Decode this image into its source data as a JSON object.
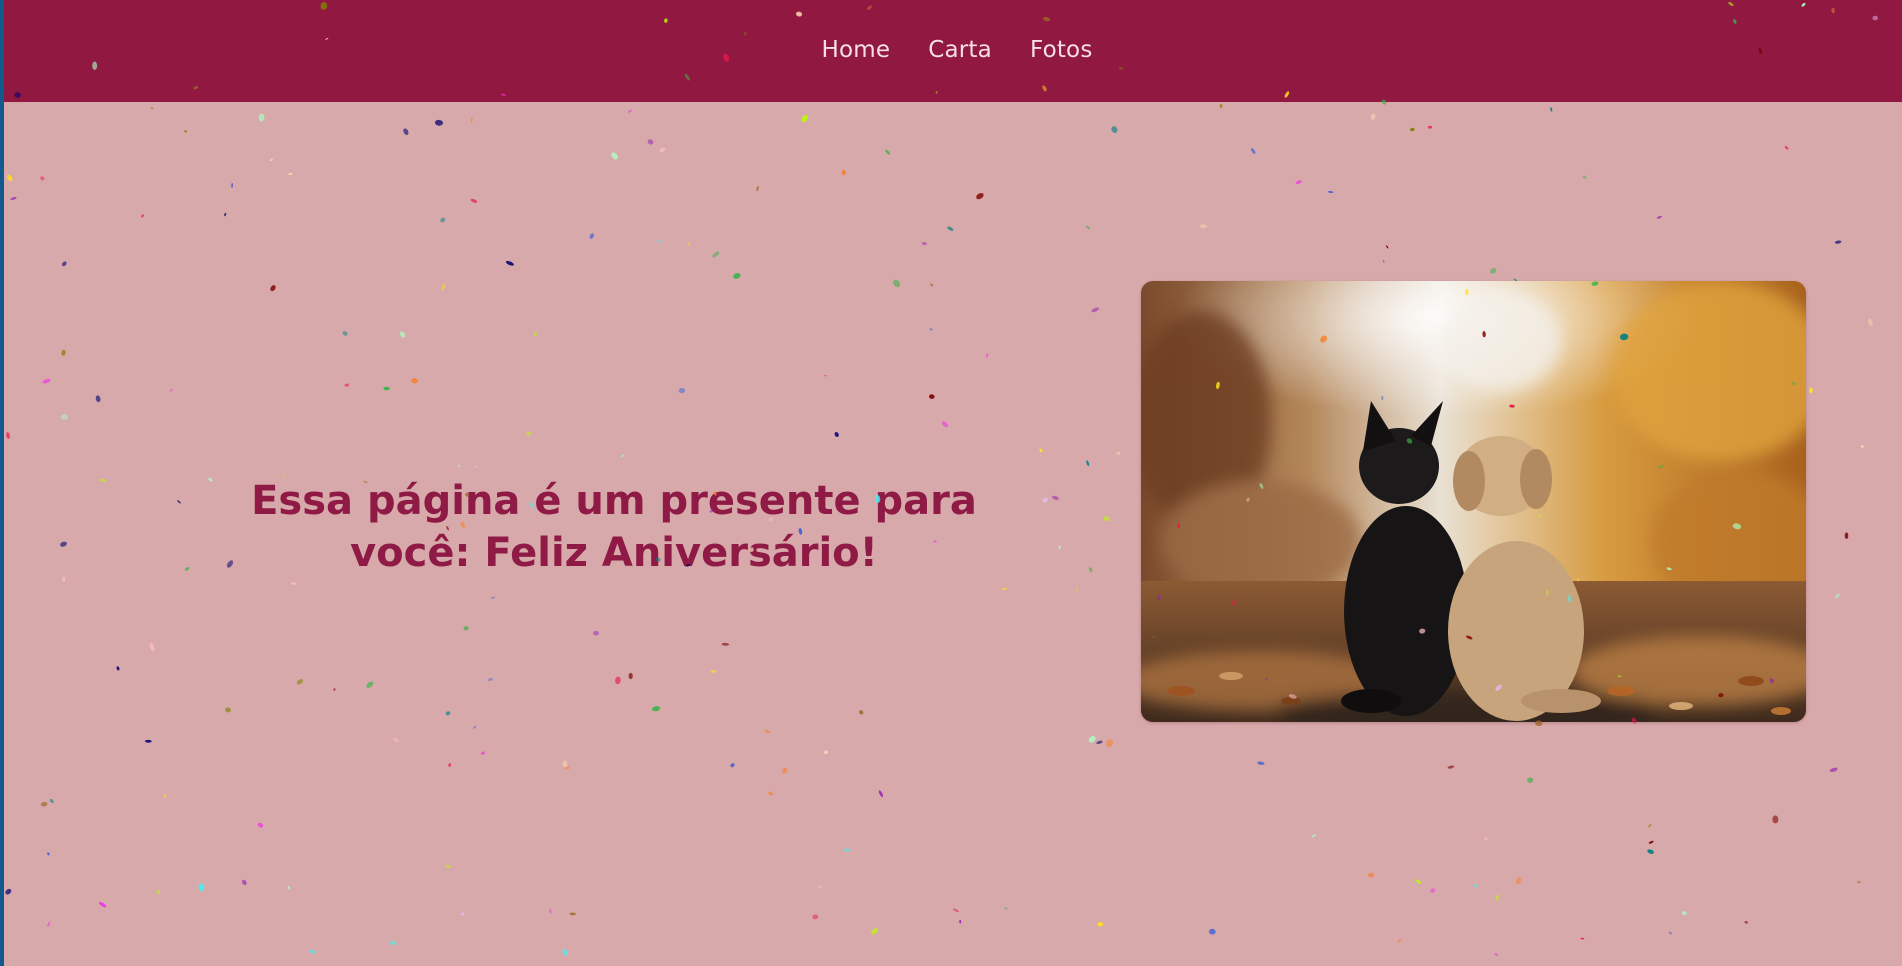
{
  "nav": {
    "items": [
      {
        "label": "Home"
      },
      {
        "label": "Carta"
      },
      {
        "label": "Fotos"
      }
    ]
  },
  "hero": {
    "title": "Essa página é um presente para você: Feliz Aniversário!",
    "image_subject": "dogs-photo"
  },
  "colors": {
    "navbar": "#911840",
    "background": "#d8a9aa",
    "title": "#8e1a45",
    "nav_text": "#f6dfe5"
  }
}
